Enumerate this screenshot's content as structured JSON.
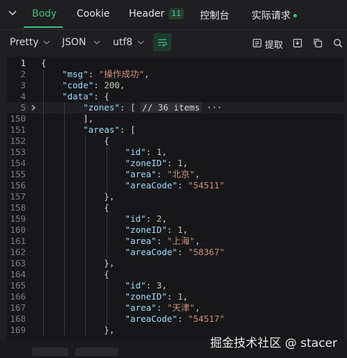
{
  "tabs": {
    "body": "Body",
    "cookie": "Cookie",
    "header": "Header",
    "header_count": "11",
    "console": "控制台",
    "realtime": "实际请求"
  },
  "toolbar": {
    "format": "Pretty",
    "type": "JSON",
    "encoding": "utf8",
    "extract": "提取"
  },
  "editor": {
    "lines": [
      {
        "no": "1",
        "text": "{"
      },
      {
        "no": "2",
        "text": "    \"msg\": \"操作成功\","
      },
      {
        "no": "3",
        "text": "    \"code\": 200,"
      },
      {
        "no": "4",
        "text": "    \"data\": {"
      },
      {
        "no": "5",
        "text": "        \"zones\": [ // 36 items ···"
      },
      {
        "no": "150",
        "text": "        ],"
      },
      {
        "no": "151",
        "text": "        \"areas\": ["
      },
      {
        "no": "152",
        "text": "            {"
      },
      {
        "no": "153",
        "text": "                \"id\": 1,"
      },
      {
        "no": "154",
        "text": "                \"zoneID\": 1,"
      },
      {
        "no": "155",
        "text": "                \"area\": \"北京\","
      },
      {
        "no": "156",
        "text": "                \"areaCode\": \"54511\""
      },
      {
        "no": "157",
        "text": "            },"
      },
      {
        "no": "158",
        "text": "            {"
      },
      {
        "no": "159",
        "text": "                \"id\": 2,"
      },
      {
        "no": "160",
        "text": "                \"zoneID\": 1,"
      },
      {
        "no": "161",
        "text": "                \"area\": \"上海\","
      },
      {
        "no": "162",
        "text": "                \"areaCode\": \"58367\""
      },
      {
        "no": "163",
        "text": "            },"
      },
      {
        "no": "164",
        "text": "            {"
      },
      {
        "no": "165",
        "text": "                \"id\": 3,"
      },
      {
        "no": "166",
        "text": "                \"zoneID\": 1,"
      },
      {
        "no": "167",
        "text": "                \"area\": \"天津\","
      },
      {
        "no": "168",
        "text": "                \"areaCode\": \"54517\""
      },
      {
        "no": "169",
        "text": "            },"
      }
    ]
  },
  "watermark": "掘金技术社区 @ stacer",
  "colors": {
    "accent": "#3fbf7f",
    "key": "#9cdcfe",
    "string": "#ce9178",
    "number": "#b5cea8"
  }
}
